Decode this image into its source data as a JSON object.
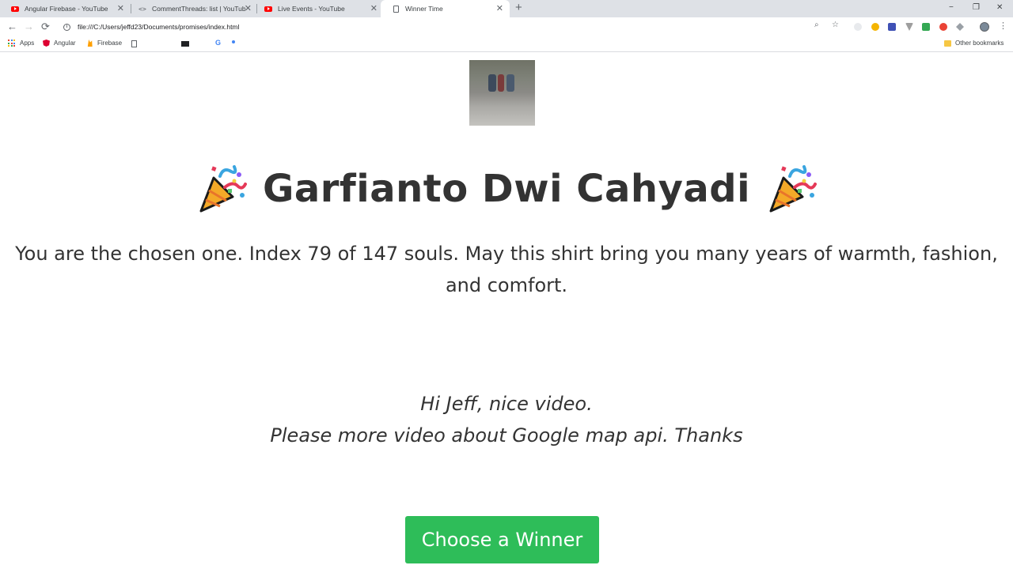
{
  "browser": {
    "tabs": [
      {
        "title": "Angular Firebase - YouTube",
        "icon": "youtube-icon",
        "active": false
      },
      {
        "title": "CommentThreads: list | YouTub...",
        "icon": "code-icon",
        "active": false
      },
      {
        "title": "Live Events - YouTube",
        "icon": "youtube-icon",
        "active": false
      },
      {
        "title": "Winner Time",
        "icon": "document-icon",
        "active": true
      }
    ],
    "new_tab_icon": "+",
    "window_controls": {
      "minimize": "−",
      "restore": "❐",
      "close": "✕"
    },
    "nav": {
      "back": "←",
      "forward": "→",
      "reload": "⟳"
    },
    "url": "file:///C:/Users/jeffd23/Documents/promises/index.html",
    "bookmarks": [
      {
        "label": "Apps",
        "icon": "apps-icon"
      },
      {
        "label": "Angular",
        "icon": "angular-icon"
      },
      {
        "label": "Firebase",
        "icon": "firebase-icon"
      }
    ],
    "other_bookmarks": "Other bookmarks"
  },
  "winner": {
    "name": "Garfianto Dwi Cahyadi",
    "announcement": "You are the chosen one. Index 79 of 147 souls. May this shirt bring you many years of warmth, fashion, and comfort.",
    "comment_line1": "Hi Jeff, nice video.",
    "comment_line2": "Please more video about Google map api. Thanks"
  },
  "actions": {
    "choose_label": "Choose a Winner"
  },
  "colors": {
    "button_green": "#2ebd59",
    "text": "#333333"
  }
}
